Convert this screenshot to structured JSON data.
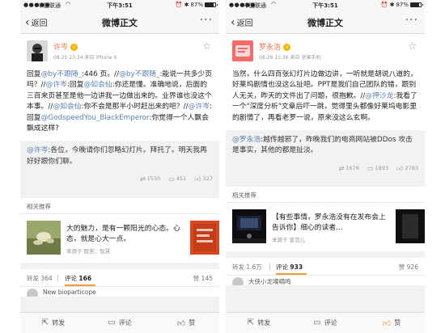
{
  "status": {
    "carrier": "中国联通",
    "time": "下午3:51",
    "battery_text": "87%",
    "battery_level": 0.87
  },
  "nav": {
    "back_label": "返回",
    "title": "微博正文",
    "more": "···"
  },
  "left": {
    "author_name": "许岑",
    "meta": "08-25 23:34  来自 iPhone 6",
    "content_parts": [
      {
        "t": "回复"
      },
      {
        "t": "@by不跟随_",
        "m": true
      },
      {
        "t": ":446 页。//"
      },
      {
        "t": "@by不跟随_",
        "m": true
      },
      {
        "t": ":能说一共多少页吗？//"
      },
      {
        "t": "@许岑",
        "m": true
      },
      {
        "t": ":回复"
      },
      {
        "t": "@如会仙",
        "m": true
      },
      {
        "t": ":你还是懂。准确地说，后面的三百来页甚至是他一边讲我一边做出来的。业界谁也没这个本事。//"
      },
      {
        "t": "@如会仙",
        "m": true
      },
      {
        "t": ":你不会是那半小时赶出来的吧？//"
      },
      {
        "t": "@许岑",
        "m": true
      },
      {
        "t": ":回复"
      },
      {
        "t": "@GodspeedYou_BlackEmperor",
        "m": true
      },
      {
        "t": ":你觉得一个人飘会飘成这样?"
      }
    ],
    "repost_parts": [
      {
        "t": "@许岑",
        "m": true
      },
      {
        "t": ":各位，今晚请你们忽略幻灯片。拜托了。明天我再好好跟你们聊。"
      }
    ],
    "stats": {
      "reposts": "1530",
      "comments": "451",
      "likes": "327"
    },
    "rec_header": "相关推荐",
    "rec_text": "大的魅力，是有一颗阳光的心态。心态，就是心大一点。",
    "rec_source": "来源于 股若、智慧",
    "tabs": {
      "repost": "转发 364",
      "comment_label": "评论",
      "comment_count": "166",
      "like": "赞 145"
    },
    "peek_name": "New bioparticope"
  },
  "right": {
    "author_name": "罗永浩",
    "meta": "08-26 11:36  来自 坚果手机",
    "content_parts": [
      {
        "t": "当然，什么四百张幻灯片边做边讲，一听就是胡说八道的，好莱坞剧情也没这么扯吧。PPT是我们自己团队的错，跟别人无关，昨天的文件出了问题，很抱歉。//"
      },
      {
        "t": "@押沙龙",
        "m": true
      },
      {
        "t": ":我看了一个\"深度分析\"文章后吓一跳，觉得里头都像好莱坞电影里的剧情了，再看老罗一说，原来没这么玄啊。"
      }
    ],
    "repost_parts": [
      {
        "t": "@罗永浩",
        "m": true
      },
      {
        "t": ":越传越邪了，昨晚我们的电商网站被DDos 攻击是事实，其他的都是扯淡。"
      }
    ],
    "stats": {
      "reposts": "1676",
      "comments": "1893",
      "likes": "2783"
    },
    "rec_header": "相关推荐",
    "rec_text": "【有些事情，罗永浩没有在发布会上告诉你】细心的读者...",
    "rec_source": "来源于 爱范儿",
    "tabs": {
      "repost": "转发 1.6万",
      "comment_label": "评论",
      "comment_count": "933",
      "like": "赞 926"
    },
    "peek_name": "大侠小龙嘀嘀鸣"
  },
  "toolbar": {
    "repost": "转发",
    "comment": "评论",
    "like": "赞"
  },
  "icons": {
    "back": "chevron-left-icon",
    "star": "star-icon",
    "repost": "repost-icon",
    "comment": "comment-icon",
    "like": "thumbs-up-icon"
  },
  "colors": {
    "mention": "#5a7fb3",
    "author": "#eb7350",
    "tab_underline": "#f29c38",
    "like_active": "#f08a2b"
  }
}
